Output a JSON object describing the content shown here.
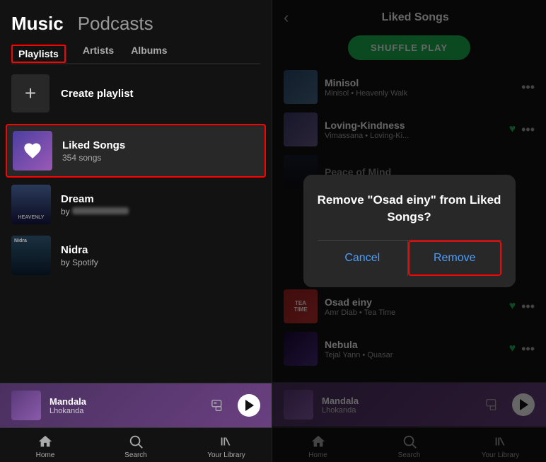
{
  "left": {
    "music_label": "Music",
    "podcasts_label": "Podcasts",
    "tabs": [
      {
        "id": "playlists",
        "label": "Playlists",
        "active": true
      },
      {
        "id": "artists",
        "label": "Artists",
        "active": false
      },
      {
        "id": "albums",
        "label": "Albums",
        "active": false
      }
    ],
    "create_playlist_label": "Create playlist",
    "playlists": [
      {
        "id": "liked-songs",
        "name": "Liked Songs",
        "sub": "354 songs",
        "type": "liked",
        "highlighted": true
      },
      {
        "id": "dream",
        "name": "Dream",
        "sub": "by ...",
        "type": "dream",
        "highlighted": false
      },
      {
        "id": "nidra",
        "name": "Nidra",
        "sub": "by Spotify",
        "type": "nidra",
        "highlighted": false
      }
    ],
    "player": {
      "track": "Mandala",
      "artist": "Lhokanda"
    },
    "nav": [
      {
        "id": "home",
        "label": "Home",
        "icon": "⌂"
      },
      {
        "id": "search",
        "label": "Search",
        "icon": "⌕"
      },
      {
        "id": "library",
        "label": "Your Library",
        "icon": "|||\\"
      }
    ]
  },
  "right": {
    "page_title": "Liked Songs",
    "shuffle_label": "SHUFFLE PLAY",
    "songs": [
      {
        "id": "minisol",
        "name": "Minisol",
        "artist": "Minisol • Heavenly Walk",
        "type": "minisol",
        "has_heart": false
      },
      {
        "id": "loving-kindness",
        "name": "Loving-Kindness",
        "artist": "Vimassana • Loving-Ki...",
        "type": "loving",
        "has_heart": true
      },
      {
        "id": "peace-of-mind",
        "name": "Peace of Mind",
        "artist": "",
        "type": "dream",
        "has_heart": false
      },
      {
        "id": "osad-einy",
        "name": "Osad einy",
        "artist": "Amr Diab • Tea Time",
        "type": "osad",
        "has_heart": true
      },
      {
        "id": "nebula",
        "name": "Nebula",
        "artist": "Tejal Yann • Quasar",
        "type": "nebula",
        "has_heart": true
      }
    ],
    "modal": {
      "title": "Remove \"Osad einy\" from Liked Songs?",
      "cancel_label": "Cancel",
      "remove_label": "Remove"
    },
    "player": {
      "track": "Mandala",
      "artist": "Lhokanda"
    },
    "nav": [
      {
        "id": "home",
        "label": "Home",
        "icon": "⌂"
      },
      {
        "id": "search",
        "label": "Search",
        "icon": "⌕"
      },
      {
        "id": "library",
        "label": "Your Library",
        "icon": "|||\\ "
      }
    ]
  }
}
